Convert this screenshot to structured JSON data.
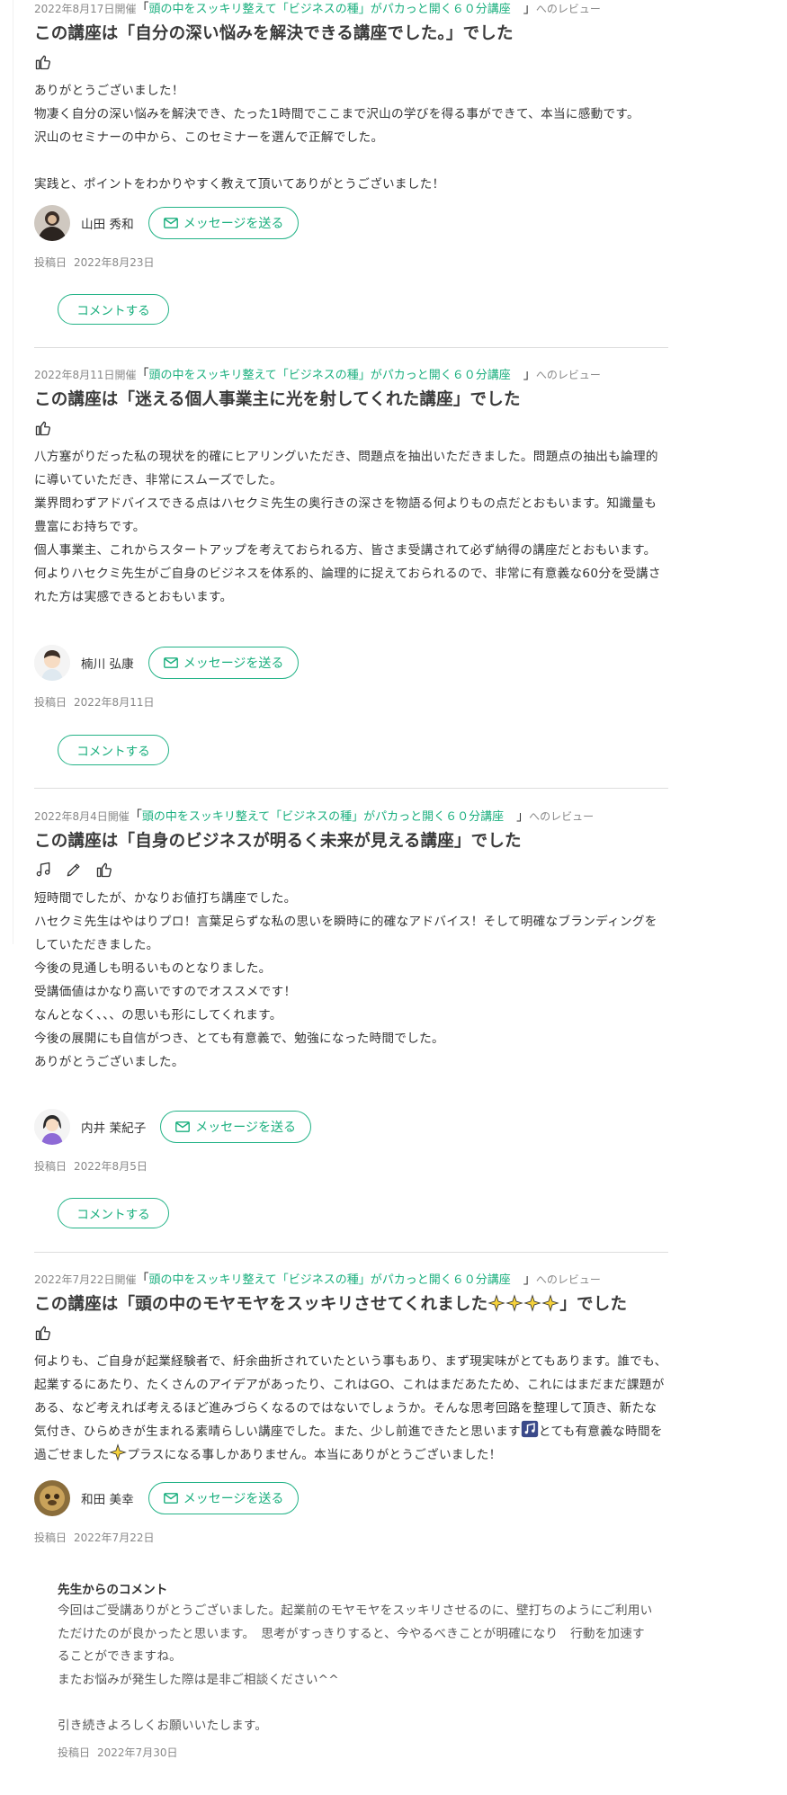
{
  "reviews": [
    {
      "date_held": "2022年8月17日開催",
      "course_title": "頭の中をスッキリ整えて「ビジネスの種」がパカっと開く６０分講座",
      "review_suffix": "へのレビュー",
      "headline": "この講座は「自分の深い悩みを解決できる講座でした。」でした",
      "icons": [
        "thumbs-up-icon"
      ],
      "body": "ありがとうございました！\n物凄く自分の深い悩みを解決でき、たった1時間でここまで沢山の学びを得る事ができて、本当に感動です。\n沢山のセミナーの中から、このセミナーを選んで正解でした。\n\n実践と、ポイントをわかりやすく教えて頂いてありがとうございました！",
      "author_name": "山田 秀和",
      "message_button": "メッセージを送る",
      "posted_label": "投稿日",
      "posted_date": "2022年8月23日",
      "comment_button": "コメントする"
    },
    {
      "date_held": "2022年8月11日開催",
      "course_title": "頭の中をスッキリ整えて「ビジネスの種」がパカっと開く６０分講座",
      "review_suffix": "へのレビュー",
      "headline": "この講座は「迷える個人事業主に光を射してくれた講座」でした",
      "icons": [
        "thumbs-up-icon"
      ],
      "body": "八方塞がりだった私の現状を的確にヒアリングいただき、問題点を抽出いただきました。問題点の抽出も論理的に導いていただき、非常にスムーズでした。\n業界問わずアドバイスできる点はハセクミ先生の奥行きの深さを物語る何よりもの点だとおもいます。知識量も豊富にお持ちです。\n個人事業主、これからスタートアップを考えておられる方、皆さま受講されて必ず納得の講座だとおもいます。\n何よりハセクミ先生がご自身のビジネスを体系的、論理的に捉えておられるので、非常に有意義な60分を受講された方は実感できるとおもいます。",
      "author_name": "楠川 弘康",
      "message_button": "メッセージを送る",
      "posted_label": "投稿日",
      "posted_date": "2022年8月11日",
      "comment_button": "コメントする"
    },
    {
      "date_held": "2022年8月4日開催",
      "course_title": "頭の中をスッキリ整えて「ビジネスの種」がパカっと開く６０分講座",
      "review_suffix": "へのレビュー",
      "headline": "この講座は「自身のビジネスが明るく未来が見える講座」でした",
      "icons": [
        "music-note-icon",
        "pencil-icon",
        "thumbs-up-icon"
      ],
      "body": "短時間でしたが、かなりお値打ち講座でした。\nハセクミ先生はやはりプロ！言葉足らずな私の思いを瞬時に的確なアドバイス！そして明確なブランディングをしていただきました。\n今後の見通しも明るいものとなりました。\n受講価値はかなり高いですのでオススメです！\nなんとなく、、、の思いも形にしてくれます。\n今後の展開にも自信がつき、とても有意義で、勉強になった時間でした。\nありがとうございました。",
      "author_name": "内井 茉紀子",
      "message_button": "メッセージを送る",
      "posted_label": "投稿日",
      "posted_date": "2022年8月5日",
      "comment_button": "コメントする"
    },
    {
      "date_held": "2022年7月22日開催",
      "course_title": "頭の中をスッキリ整えて「ビジネスの種」がパカっと開く６０分講座",
      "review_suffix": "へのレビュー",
      "headline_before": "この講座は「頭の中のモヤモヤをスッキリさせてくれました",
      "headline_after": "」でした",
      "icons": [
        "thumbs-up-icon"
      ],
      "body_part1": "何よりも、ご自身が起業経験者で、紆余曲折されていたという事もあり、まず現実味がとてもあります。誰でも、起業するにあたり、たくさんのアイデアがあったり、これはGO、これはまだあたため、これにはまだまだ課題がある、など考えれば考えるほど進みづらくなるのではないでしょうか。そんな思考回路を整理して頂き、新たな気付き、ひらめきが生まれる素晴らしい講座でした。また、少し前進できたと思います",
      "body_part2": "とても有意義な時間を過ごせました",
      "body_part3": "プラスになる事しかありません。本当にありがとうございました！",
      "author_name": "和田 美幸",
      "message_button": "メッセージを送る",
      "posted_label": "投稿日",
      "posted_date": "2022年7月22日",
      "teacher_comment": {
        "title": "先生からのコメント",
        "body": "今回はご受講ありがとうございました。起業前のモヤモヤをスッキリさせるのに、壁打ちのようにご利用いただけたのが良かったと思います。　思考がすっきりすると、今やるべきことが明確になり　行動を加速することができますね。\nまたお悩みが発生した際は是非ご相談ください^^\n\n引き続きよろしくお願いいたします。",
        "posted_label": "投稿日",
        "posted_date": "2022年7月30日"
      }
    }
  ],
  "colors": {
    "accent": "#1aaf7e",
    "button_border": "#23b387",
    "text": "#333333",
    "muted": "#888888",
    "divider": "#dddddd"
  }
}
